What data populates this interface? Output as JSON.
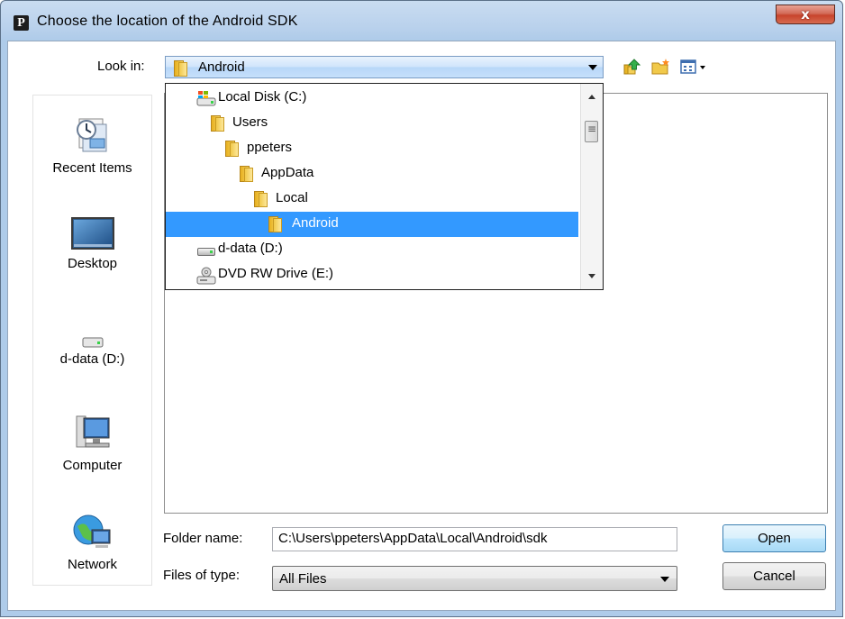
{
  "window": {
    "title": "Choose the location of the Android SDK",
    "app_icon_letter": "P",
    "close_label": "x"
  },
  "toolbar": {
    "look_in_label": "Look in:",
    "look_in_value": "Android",
    "icons": [
      "up-one-level-icon",
      "create-new-folder-icon",
      "view-menu-icon"
    ]
  },
  "places": [
    {
      "label": "Recent Items",
      "icon": "recent-items-icon"
    },
    {
      "label": "Desktop",
      "icon": "desktop-icon"
    },
    {
      "label": "d-data (D:)",
      "icon": "drive-icon"
    },
    {
      "label": "Computer",
      "icon": "computer-icon"
    },
    {
      "label": "Network",
      "icon": "network-icon"
    }
  ],
  "dropdown": {
    "items": [
      {
        "label": "Local Disk (C:)",
        "icon": "local-disk-icon",
        "selected": false
      },
      {
        "label": "Users",
        "icon": "folder-icon",
        "selected": false
      },
      {
        "label": "ppeters",
        "icon": "folder-icon",
        "selected": false
      },
      {
        "label": "AppData",
        "icon": "folder-icon",
        "selected": false
      },
      {
        "label": "Local",
        "icon": "folder-icon",
        "selected": false
      },
      {
        "label": "Android",
        "icon": "folder-icon",
        "selected": true
      },
      {
        "label": "d-data (D:)",
        "icon": "drive-icon",
        "selected": false
      },
      {
        "label": "DVD RW Drive (E:)",
        "icon": "dvd-drive-icon",
        "selected": false
      }
    ]
  },
  "form": {
    "folder_name_label": "Folder name:",
    "folder_name_value": "C:\\Users\\ppeters\\AppData\\Local\\Android\\sdk",
    "files_of_type_label": "Files of type:",
    "files_of_type_value": "All Files"
  },
  "buttons": {
    "open": "Open",
    "cancel": "Cancel"
  },
  "colors": {
    "selection": "#3399ff",
    "titlebar": "#b9d1ec",
    "close": "#c7442c"
  }
}
